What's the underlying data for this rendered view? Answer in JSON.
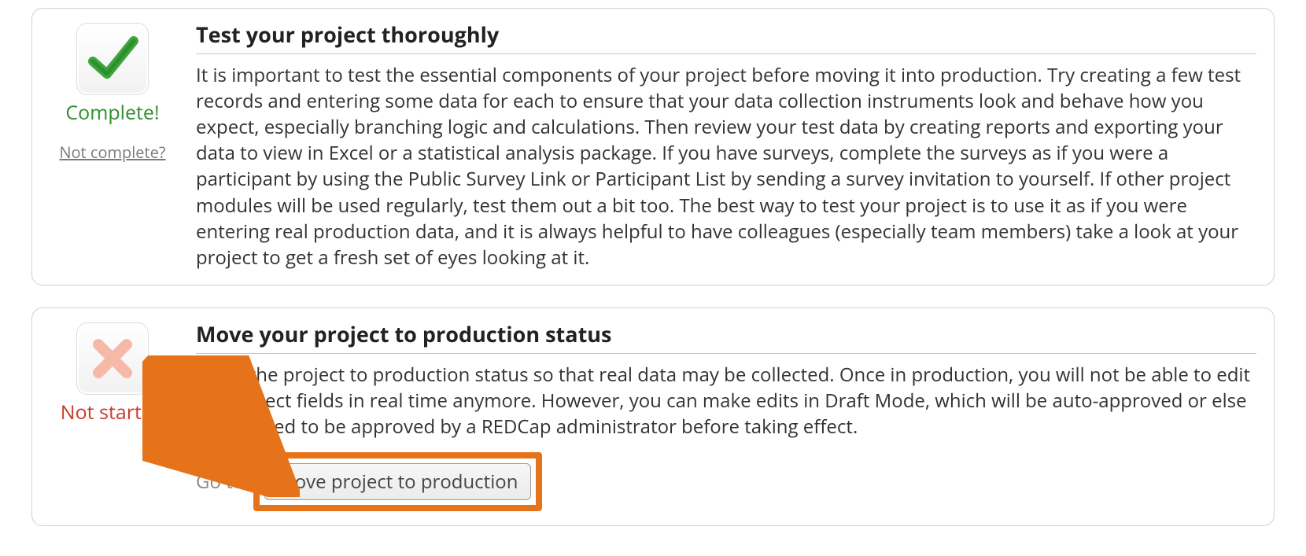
{
  "steps": [
    {
      "status_label": "Complete!",
      "status_class": "complete",
      "not_complete_link": "Not complete?",
      "icon": "check",
      "title": "Test your project thoroughly",
      "body": "It is important to test the essential components of your project before moving it into production. Try creating a few test records and entering some data for each to ensure that your data collection instruments look and behave how you expect, especially branching logic and calculations. Then review your test data by creating reports and exporting your data to view in Excel or a statistical analysis package. If you have surveys, complete the surveys as if you were a participant by using the Public Survey Link or Participant List by sending a survey invitation to yourself. If other project modules will be used regularly, test them out a bit too. The best way to test your project is to use it as if you were entering real production data, and it is always helpful to have colleagues (especially team members) take a look at your project to get a fresh set of eyes looking at it."
    },
    {
      "status_label": "Not started",
      "status_class": "not-started",
      "icon": "x",
      "title": "Move your project to production status",
      "body": "Move the project to production status so that real data may be collected. Once in production, you will not be able to edit the project fields in real time anymore. However, you can make edits in Draft Mode, which will be auto-approved or else might need to be approved by a REDCap administrator before taking effect.",
      "goto_label": "Go to",
      "button_label": "Move project to production"
    }
  ],
  "annotation": {
    "arrow_color": "#e6731a"
  }
}
